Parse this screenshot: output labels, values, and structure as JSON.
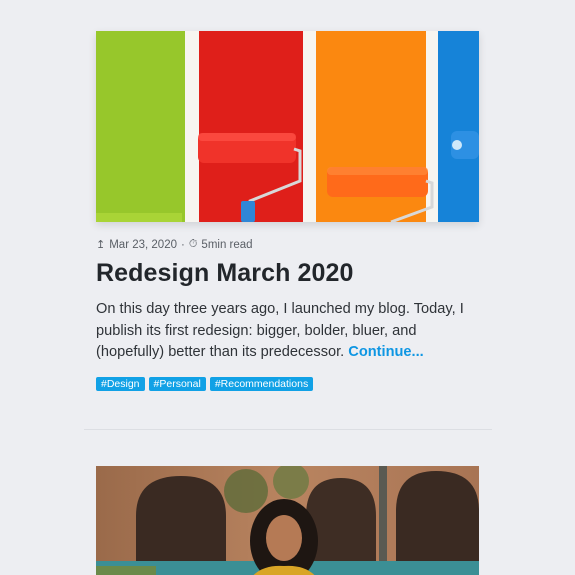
{
  "posts": [
    {
      "meta": {
        "upload_icon": "upload-icon",
        "date": "Mar 23, 2020",
        "separator": "·",
        "timer_icon": "timer-icon",
        "read_time": "5min read"
      },
      "title": "Redesign March 2020",
      "excerpt": "On this day three years ago, I launched my blog. Today, I publish its first redesign: bigger, bolder, bluer, and (hopefully) better than its predecessor.",
      "continue_label": "Continue...",
      "tags": [
        "#Design",
        "#Personal",
        "#Recommendations"
      ]
    }
  ],
  "colors": {
    "accent": "#11a1e6",
    "link": "#0e96e3",
    "background": "#edeef2",
    "title": "#22262b"
  }
}
